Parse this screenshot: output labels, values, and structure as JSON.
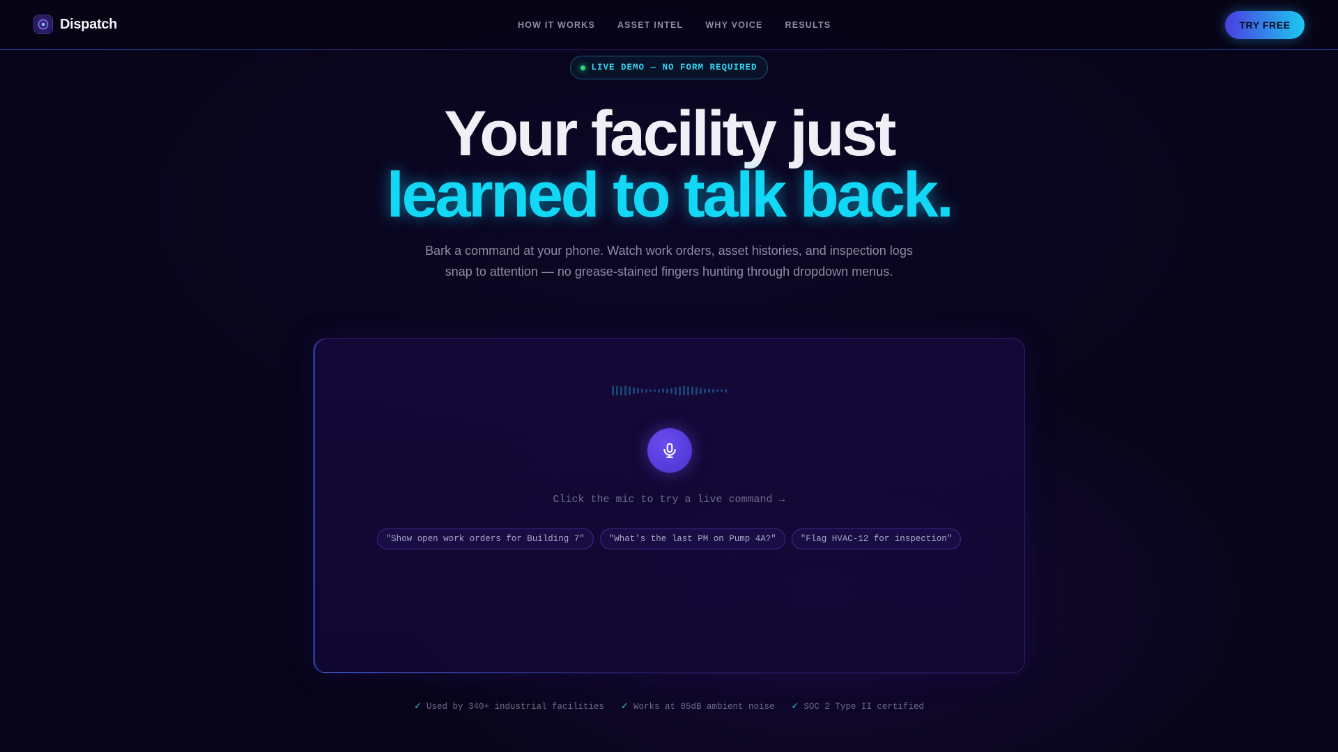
{
  "nav": {
    "brand": "Dispatch",
    "links": [
      "HOW IT WORKS",
      "ASSET INTEL",
      "WHY VOICE",
      "RESULTS"
    ],
    "cta": "TRY FREE"
  },
  "badge": {
    "text": "LIVE DEMO — NO FORM REQUIRED"
  },
  "hero": {
    "line1": "Your facility just",
    "line2": "learned to talk back.",
    "subtitle": "Bark a command at your phone. Watch work orders, asset histories, and inspection logs snap to attention — no grease-stained fingers hunting through dropdown menus."
  },
  "demo": {
    "mic_icon": "microphone-icon",
    "hint": "Click the mic to try a live command →",
    "chips": [
      "\"Show open work orders for Building 7\"",
      "\"What's the last PM on Pump 4A?\"",
      "\"Flag HVAC-12 for inspection\""
    ]
  },
  "trust": [
    "Used by 340+ industrial facilities",
    "Works at 85dB ambient noise",
    "SOC 2 Type II certified"
  ],
  "colors": {
    "background": "#08051a",
    "accent_cyan": "#12d8f6",
    "accent_purple": "#4a3ee0",
    "live_green": "#22e07a"
  }
}
